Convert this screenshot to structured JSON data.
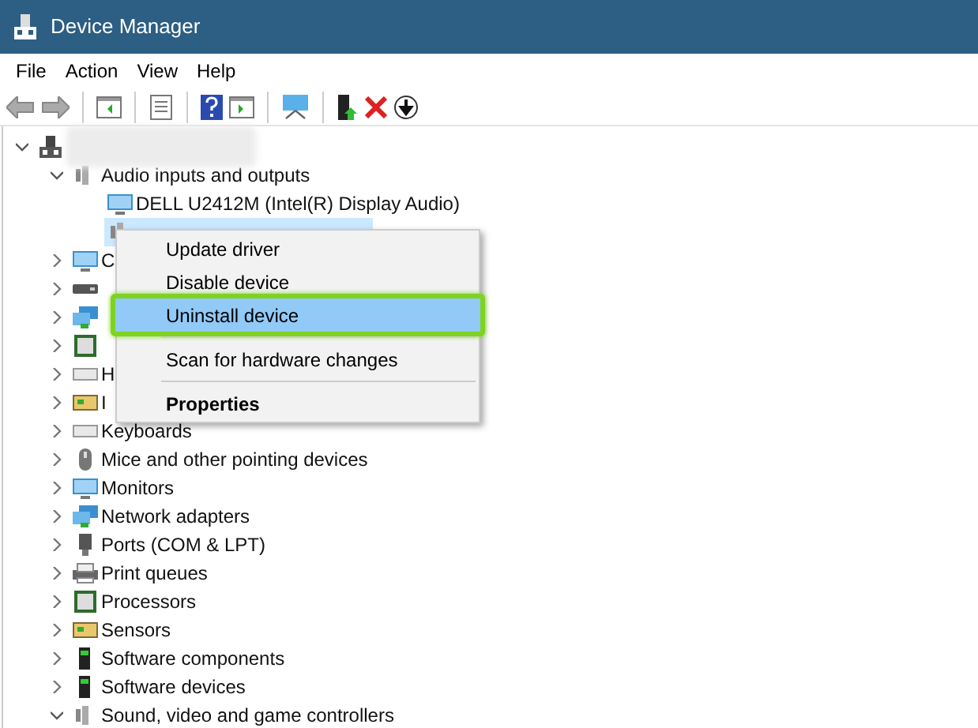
{
  "window": {
    "title": "Device Manager"
  },
  "menu_bar": [
    {
      "label": "File"
    },
    {
      "label": "Action"
    },
    {
      "label": "View"
    },
    {
      "label": "Help"
    }
  ],
  "tree": [
    {
      "kind": "computer",
      "expanded": true,
      "selected": false,
      "children": [
        {
          "kind": "speaker",
          "label": "Audio inputs and outputs",
          "expanded": true,
          "selected": false,
          "children": [
            {
              "kind": "monitor",
              "label": "DELL U2412M (Intel(R) Display Audio)",
              "selected": false
            },
            {
              "kind": "speaker",
              "selected": true
            }
          ]
        },
        {
          "kind": "monitor",
          "label": "C",
          "expanded": false,
          "selected": false
        },
        {
          "kind": "disk",
          "expanded": false,
          "selected": false
        },
        {
          "kind": "network",
          "expanded": false,
          "selected": false
        },
        {
          "kind": "chip",
          "expanded": false,
          "selected": false
        },
        {
          "kind": "keyboard",
          "label": "H",
          "expanded": false,
          "selected": false
        },
        {
          "kind": "sensor",
          "label": "I",
          "expanded": false,
          "selected": false
        },
        {
          "kind": "keyboard",
          "label": "Keyboards",
          "expanded": false,
          "selected": false
        },
        {
          "kind": "mouse",
          "label": "Mice and other pointing devices",
          "expanded": false,
          "selected": false
        },
        {
          "kind": "monitor",
          "label": "Monitors",
          "expanded": false,
          "selected": false
        },
        {
          "kind": "network",
          "label": "Network adapters",
          "expanded": false,
          "selected": false
        },
        {
          "kind": "port",
          "label": "Ports (COM & LPT)",
          "expanded": false,
          "selected": false
        },
        {
          "kind": "printer",
          "label": "Print queues",
          "expanded": false,
          "selected": false
        },
        {
          "kind": "chip",
          "label": "Processors",
          "expanded": false,
          "selected": false
        },
        {
          "kind": "sensor",
          "label": "Sensors",
          "expanded": false,
          "selected": false
        },
        {
          "kind": "software",
          "label": "Software components",
          "expanded": false,
          "selected": false
        },
        {
          "kind": "software",
          "label": "Software devices",
          "expanded": false,
          "selected": false
        },
        {
          "kind": "speaker",
          "label": "Sound, video and game controllers",
          "expanded": true,
          "selected": false
        }
      ]
    }
  ],
  "context_menu": [
    {
      "kind": "item",
      "label": "Update driver",
      "highlighted": false,
      "default": false
    },
    {
      "kind": "item",
      "label": "Disable device",
      "highlighted": false,
      "default": false
    },
    {
      "kind": "item",
      "label": "Uninstall device",
      "highlighted": true,
      "default": false
    },
    {
      "kind": "separator"
    },
    {
      "kind": "item",
      "label": "Scan for hardware changes",
      "highlighted": false,
      "default": false
    },
    {
      "kind": "separator"
    },
    {
      "kind": "item",
      "label": "Properties",
      "highlighted": false,
      "default": true
    }
  ]
}
